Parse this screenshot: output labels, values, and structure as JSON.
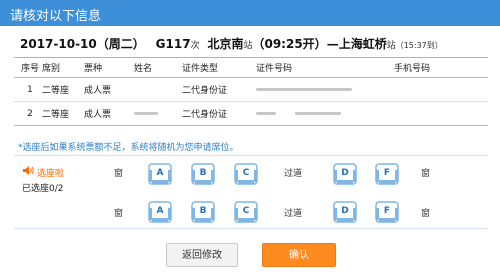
{
  "header": {
    "title": "请核对以下信息"
  },
  "trip": {
    "date": "2017-10-10",
    "weekday": "（周二）",
    "train_no": "G117",
    "train_suffix": "次",
    "from_station": "北京南",
    "from_suffix": "站",
    "depart_time": "（09:25开）",
    "separator": "—",
    "to_station": "上海虹桥",
    "to_suffix": "站",
    "arrive_time": "（15:37到）"
  },
  "table": {
    "headers": [
      "序号",
      "席别",
      "票种",
      "姓名",
      "证件类型",
      "证件号码",
      "手机号码"
    ],
    "rows": [
      {
        "no": "1",
        "seat_class": "二等座",
        "ticket_type": "成人票",
        "name": "",
        "id_type": "二代身份证",
        "id_number": "",
        "phone": ""
      },
      {
        "no": "2",
        "seat_class": "二等座",
        "ticket_type": "成人票",
        "name": "",
        "id_type": "二代身份证",
        "id_number": "",
        "phone": ""
      }
    ]
  },
  "notice": "*选座后如果系统票额不足，系统将随机为您申请席位。",
  "seat_select": {
    "title": "选座啦",
    "selected": "已选座0/2",
    "window_label": "窗",
    "aisle_label": "过道",
    "left_seats": [
      "A",
      "B",
      "C"
    ],
    "right_seats": [
      "D",
      "F"
    ]
  },
  "buttons": {
    "back": "返回修改",
    "confirm": "确认"
  },
  "colors": {
    "header": "#3c8fd8",
    "confirm": "#ff8a1e",
    "seat": "#7fb6e6",
    "warn": "#ff6a00",
    "notice": "#2b7fcc"
  },
  "icons": {
    "warn": "speaker-icon",
    "seat": "seat-icon"
  }
}
